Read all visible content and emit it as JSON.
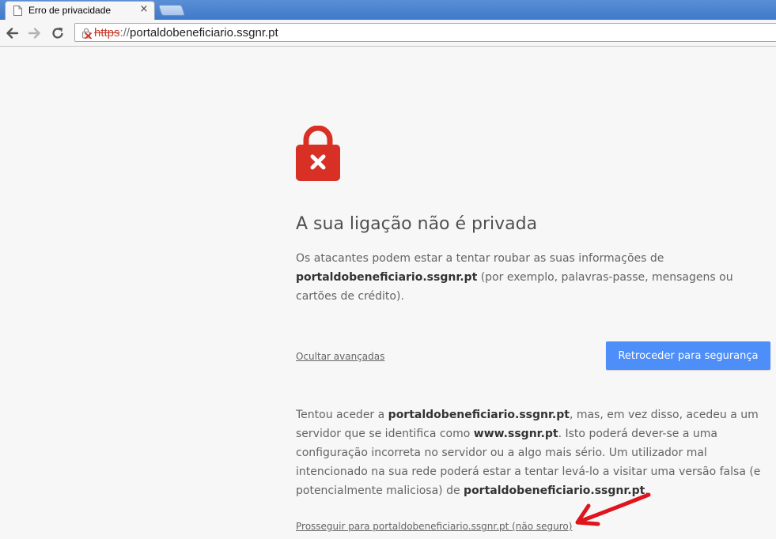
{
  "tab": {
    "title": "Erro de privacidade",
    "close": "×"
  },
  "toolbar": {
    "url_scheme": "https",
    "url_sep": "://",
    "url_host": "portaldobeneficiario.ssgnr.pt"
  },
  "icons": {
    "tab_favicon": "page-icon",
    "back": "back-arrow-icon",
    "forward": "forward-arrow-icon",
    "reload": "reload-icon",
    "url_security": "broken-lock-icon",
    "big_lock": "red-padlock-x-icon"
  },
  "colors": {
    "accent_button": "#4d8ef8",
    "lock_red": "#d93025",
    "scheme_red": "#c53929",
    "annotation_arrow": "#e0141c"
  },
  "main": {
    "heading": "A sua ligação não é privada",
    "para1_a": "Os atacantes podem estar a tentar roubar as suas informações de ",
    "para1_host": "portaldobeneficiario.ssgnr.pt",
    "para1_b": " (por exemplo, palavras-passe, mensagens ou cartões de crédito).",
    "hide_advanced": "Ocultar avançadas",
    "back_button": "Retroceder para segurança",
    "para2_a": "Tentou aceder a ",
    "para2_host": "portaldobeneficiario.ssgnr.pt",
    "para2_b": ", mas, em vez disso, acedeu a um servidor que se identifica como ",
    "para2_cert": "www.ssgnr.pt",
    "para2_c": ". Isto poderá dever-se a uma configuração incorreta no servidor ou a algo mais sério. Um utilizador mal intencionado na sua rede poderá estar a tentar levá-lo a visitar uma versão falsa (e potencialmente maliciosa) de ",
    "para2_host2": "portaldobeneficiario.ssgnr.pt",
    "para2_d": ".",
    "proceed_link": "Prosseguir para portaldobeneficiario.ssgnr.pt (não seguro)"
  }
}
